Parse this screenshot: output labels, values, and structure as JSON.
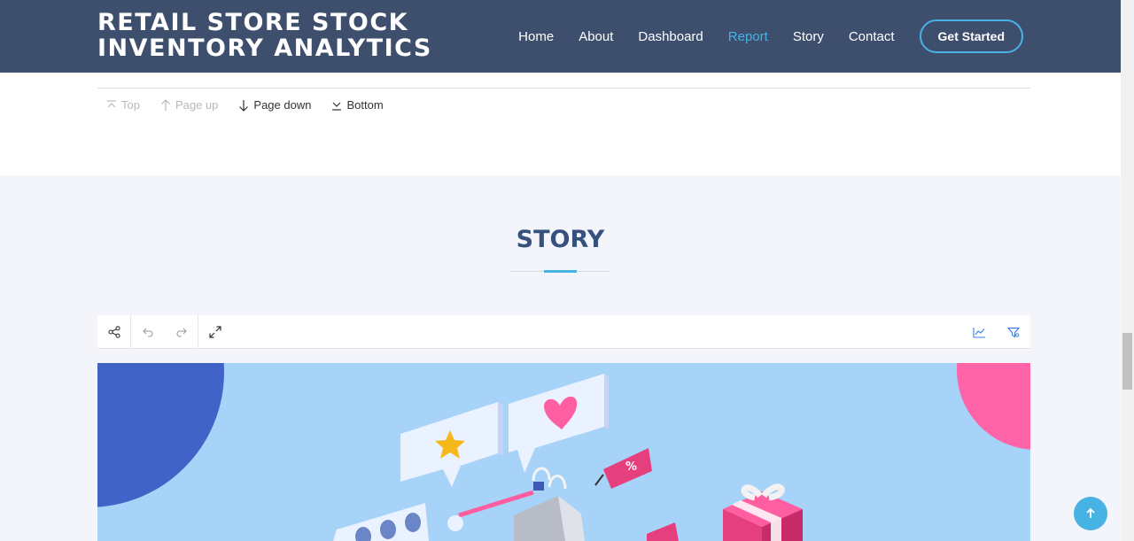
{
  "header": {
    "brand_line1": "RETAIL STORE STOCK",
    "brand_line2": "INVENTORY ANALYTICS",
    "nav": [
      {
        "label": "Home",
        "active": false
      },
      {
        "label": "About",
        "active": false
      },
      {
        "label": "Dashboard",
        "active": false
      },
      {
        "label": "Report",
        "active": true
      },
      {
        "label": "Story",
        "active": false
      },
      {
        "label": "Contact",
        "active": false
      }
    ],
    "cta_label": "Get Started"
  },
  "report_nav": {
    "top": "Top",
    "page_up": "Page up",
    "page_down": "Page down",
    "bottom": "Bottom"
  },
  "story": {
    "title": "STORY"
  },
  "toolbar": {
    "left_icons": [
      "share-icon",
      "undo-icon",
      "redo-icon",
      "fullscreen-icon"
    ],
    "right_icons": [
      "chart-icon",
      "filter-icon"
    ]
  },
  "colors": {
    "header_bg": "#3e4f6e",
    "accent": "#47b2e4",
    "title": "#37517e",
    "viz_bg": "#a7d3f8",
    "blob_blue": "#4162c6",
    "blob_pink": "#ff64a8"
  }
}
